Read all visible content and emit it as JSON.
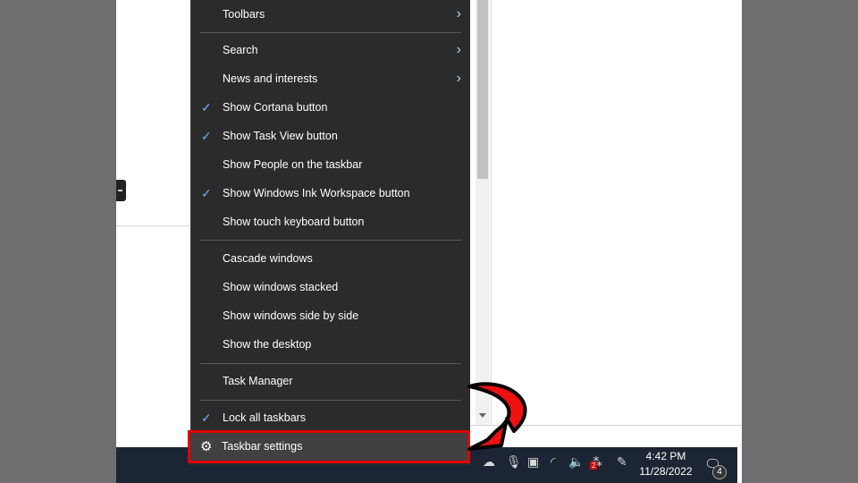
{
  "menu": {
    "items": [
      {
        "label": "Toolbars",
        "checked": false,
        "submenu": true
      },
      {
        "label": "Search",
        "checked": false,
        "submenu": true
      },
      {
        "label": "News and interests",
        "checked": false,
        "submenu": true
      },
      {
        "label": "Show Cortana button",
        "checked": true,
        "submenu": false
      },
      {
        "label": "Show Task View button",
        "checked": true,
        "submenu": false
      },
      {
        "label": "Show People on the taskbar",
        "checked": false,
        "submenu": false
      },
      {
        "label": "Show Windows Ink Workspace button",
        "checked": true,
        "submenu": false
      },
      {
        "label": "Show touch keyboard button",
        "checked": false,
        "submenu": false
      },
      {
        "label": "Cascade windows",
        "checked": false,
        "submenu": false
      },
      {
        "label": "Show windows stacked",
        "checked": false,
        "submenu": false
      },
      {
        "label": "Show windows side by side",
        "checked": false,
        "submenu": false
      },
      {
        "label": "Show the desktop",
        "checked": false,
        "submenu": false
      },
      {
        "label": "Task Manager",
        "checked": false,
        "submenu": false
      },
      {
        "label": "Lock all taskbars",
        "checked": true,
        "submenu": false
      }
    ],
    "highlighted": {
      "label": "Taskbar settings",
      "icon": "gear-icon"
    },
    "check_glyph": "✓",
    "chevron_glyph": "›",
    "gear_glyph": "⚙"
  },
  "taskbar": {
    "time": "4:42 PM",
    "date": "11/28/2022",
    "notification_count": "4",
    "tray_icons": [
      "onedrive-icon",
      "microphone-icon",
      "screen-capture-icon",
      "wifi-icon",
      "volume-icon",
      "dropbox-icon",
      "pen-icon"
    ],
    "dropbox_badge": "2"
  },
  "colors": {
    "highlight_border": "#e00000",
    "menu_bg": "#2b2b2b",
    "taskbar_bg": "#1c2533"
  }
}
